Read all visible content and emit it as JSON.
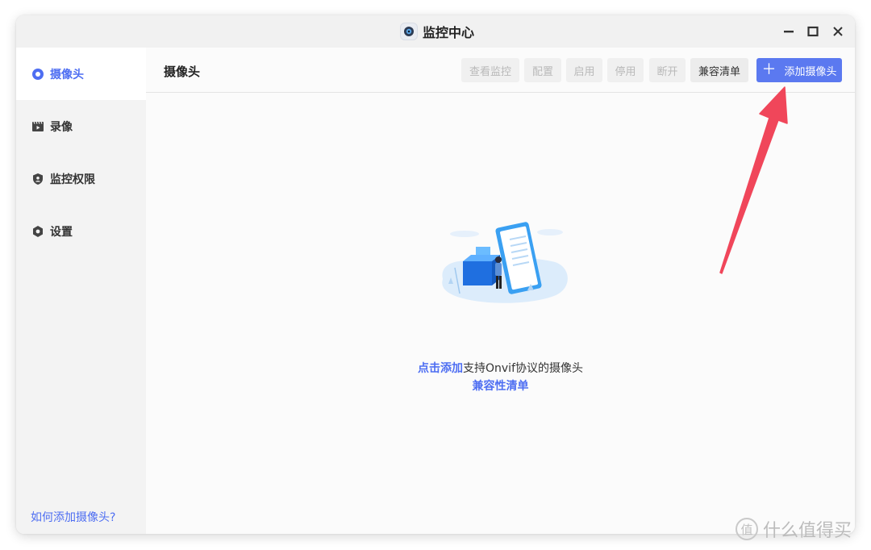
{
  "window": {
    "title": "监控中心",
    "controls": [
      "minimize-icon",
      "maximize-icon",
      "close-icon"
    ]
  },
  "sidebar": {
    "items": [
      {
        "label": "摄像头",
        "icon": "camera-icon",
        "active": true
      },
      {
        "label": "录像",
        "icon": "video-icon",
        "active": false
      },
      {
        "label": "监控权限",
        "icon": "shield-user-icon",
        "active": false
      },
      {
        "label": "设置",
        "icon": "gear-icon",
        "active": false
      }
    ],
    "help_link": "如何添加摄像头?"
  },
  "toolbar": {
    "title": "摄像头",
    "buttons": [
      {
        "label": "查看监控",
        "state": "disabled"
      },
      {
        "label": "配置",
        "state": "disabled"
      },
      {
        "label": "启用",
        "state": "disabled"
      },
      {
        "label": "停用",
        "state": "disabled"
      },
      {
        "label": "断开",
        "state": "disabled"
      },
      {
        "label": "兼容清单",
        "state": "normal"
      },
      {
        "label": "添加摄像头",
        "state": "primary",
        "icon": "plus-icon"
      }
    ]
  },
  "empty_state": {
    "link_text": "点击添加",
    "text": "支持Onvif协议的摄像头",
    "compat_link": "兼容性清单"
  },
  "annotation": {
    "color": "#f0465a"
  },
  "watermark": {
    "text": "什么值得买",
    "logo_char": "值"
  },
  "colors": {
    "accent": "#4e6ef2",
    "primary_button": "#5b79f0"
  }
}
